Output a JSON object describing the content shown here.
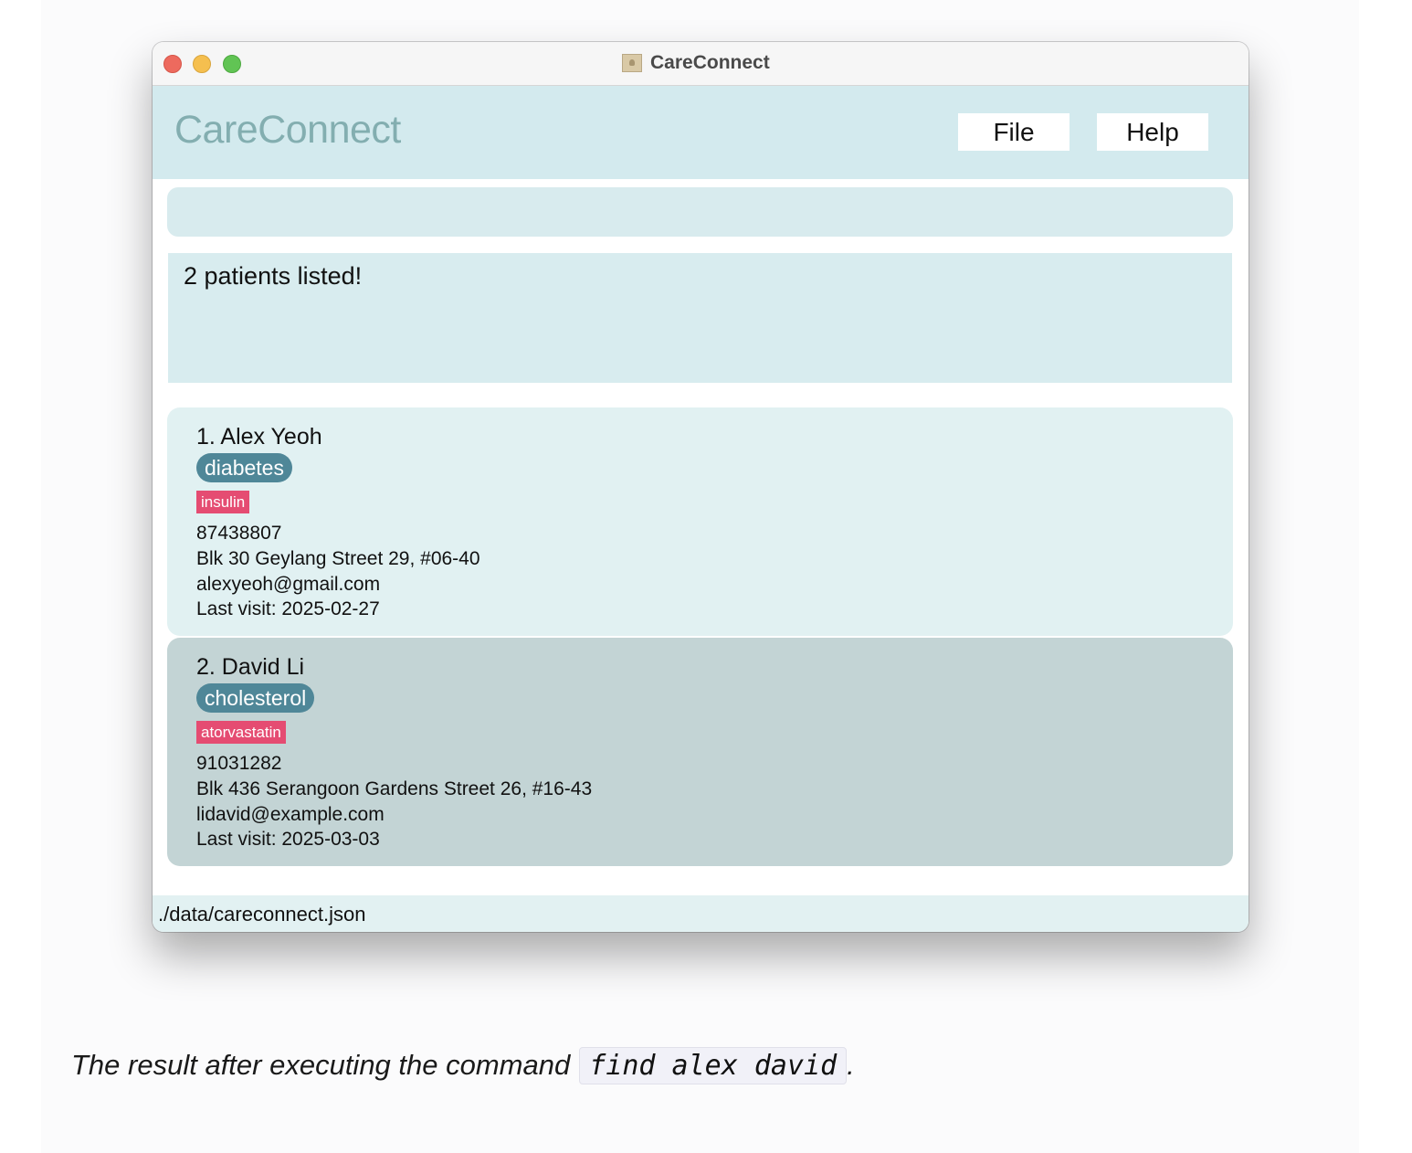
{
  "window": {
    "title": "CareConnect"
  },
  "header": {
    "brand": "CareConnect",
    "menu": [
      {
        "label": "File"
      },
      {
        "label": "Help"
      }
    ]
  },
  "command": {
    "value": ""
  },
  "result": {
    "message": "2 patients listed!"
  },
  "patients": [
    {
      "index_name": "1. Alex Yeoh",
      "condition": "diabetes",
      "medication": "insulin",
      "phone": "87438807",
      "address": "Blk 30 Geylang Street 29, #06-40",
      "email": "alexyeoh@gmail.com",
      "last_visit": "Last visit: 2025-02-27",
      "selected": false
    },
    {
      "index_name": "2. David Li",
      "condition": "cholesterol",
      "medication": "atorvastatin",
      "phone": "91031282",
      "address": "Blk 436 Serangoon Gardens Street 26, #16-43",
      "email": "lidavid@example.com",
      "last_visit": "Last visit: 2025-03-03",
      "selected": true
    }
  ],
  "status_bar": {
    "path": "./data/careconnect.json"
  },
  "caption": {
    "text": "The result after executing the command",
    "code": "find alex david",
    "suffix": "."
  },
  "colors": {
    "header_bg": "#d3eaee",
    "brand_text": "#83aeb0",
    "condition_tag": "#4f8798",
    "medication_tag": "#e54c72",
    "selected_card": "#c3d4d5",
    "card": "#e1f1f2"
  },
  "icons": {
    "app_icon": "contacts-book-icon"
  }
}
